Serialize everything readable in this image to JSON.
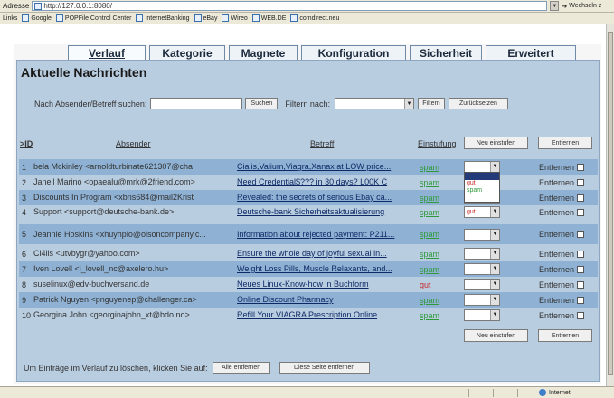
{
  "browser": {
    "address_label": "Adresse",
    "url": "http://127.0.0.1:8080/",
    "go_label": "Wechseln z",
    "links_label": "Links",
    "links": [
      "Google",
      "POPFile Control Center",
      "InternetBanking",
      "eBay",
      "Wireo",
      "WEB.DE",
      "comdirect.neu"
    ],
    "status_zone": "Internet"
  },
  "nav": {
    "tabs": [
      {
        "label": "Verlauf",
        "active": true
      },
      {
        "label": "Kategorie",
        "active": false
      },
      {
        "label": "Magnete",
        "active": false
      },
      {
        "label": "Konfiguration",
        "active": false
      },
      {
        "label": "Sicherheit",
        "active": false
      },
      {
        "label": "Erweitert",
        "active": false
      }
    ]
  },
  "page": {
    "title": "Aktuelle Nachrichten",
    "search_label": "Nach Absender/Betreff suchen:",
    "search_value": "",
    "search_button": "Suchen",
    "filter_label": "Filtern nach:",
    "filter_value": "",
    "filter_button": "Filtern",
    "reset_button": "Zurücksetzen"
  },
  "table": {
    "headers": {
      "id": ">ID",
      "sender": "Absender",
      "subject": "Betreff",
      "classification": "Einstufung",
      "reclassify_button": "Neu einstufen",
      "remove_button": "Entfernen"
    },
    "rows": [
      {
        "id": "1",
        "sender": "bela Mckinley <arnoldturbinate621307@cha",
        "subject": "Cialis,Valium,Viagra,Xanax at LOW price...",
        "classification": "spam",
        "reclass": "",
        "remove": "Entfernen"
      },
      {
        "id": "2",
        "sender": "Janell Marino <opaealu@mrk@2friend.com>",
        "subject": "Need Credential$??? in 30 days? L00K C",
        "classification": "spam",
        "reclass": "",
        "remove": "Entfernen"
      },
      {
        "id": "3",
        "sender": "Discounts In Program <xbns684@mail2Krist",
        "subject": "Revealed: the secrets of serious Ebay ca...",
        "classification": "spam",
        "reclass": "",
        "remove": "Entfernen"
      },
      {
        "id": "4",
        "sender": "Support <support@deutsche-bank.de>",
        "subject": "Deutsche-bank Sicherheitsaktualisierung",
        "classification": "spam",
        "reclass": "gut",
        "remove": "Entfernen"
      },
      {
        "id": "5",
        "sender": "Jeannie Hoskins <xhuyhpio@olsoncompany.c...",
        "subject": "Information about rejected payment: P211...",
        "classification": "spam",
        "reclass": "",
        "remove": "Entfernen"
      },
      {
        "id": "6",
        "sender": "Ci4lis <utvbygr@yahoo.com>",
        "subject": "Ensure the whole day of joyful sexual in...",
        "classification": "spam",
        "reclass": "",
        "remove": "Entfernen"
      },
      {
        "id": "7",
        "sender": "Iven Lovell <i_lovell_nc@axelero.hu>",
        "subject": "Weight Loss Pills, Muscle Relaxants, and...",
        "classification": "spam",
        "reclass": "",
        "remove": "Entfernen"
      },
      {
        "id": "8",
        "sender": "suselinux@edv-buchversand.de",
        "subject": "Neues Linux-Know-how in Buchform",
        "classification": "gut",
        "reclass": "",
        "remove": "Entfernen"
      },
      {
        "id": "9",
        "sender": "Patrick Nguyen <pnguyenep@challenger.ca>",
        "subject": "Online Discount Pharmacy",
        "classification": "spam",
        "reclass": "",
        "remove": "Entfernen"
      },
      {
        "id": "10",
        "sender": "Georgina John <georginajohn_xt@bdo.no>",
        "subject": "Refill Your VIAGRA Prescription Online",
        "classification": "spam",
        "reclass": "",
        "remove": "Entfernen"
      }
    ],
    "dropdown_options": [
      "",
      "gut",
      "spam"
    ],
    "bottom_reclassify_button": "Neu einstufen",
    "bottom_remove_button": "Entfernen"
  },
  "footer": {
    "text": "Um Einträge im Verlauf zu löschen, klicken Sie auf:",
    "remove_all_button": "Alle entfernen",
    "remove_page_button": "Diese Seite entfernen"
  },
  "colors": {
    "panel_bg": "#b9cde0",
    "row_alt": "#8fb2d4",
    "spam": "#2f9a3a",
    "gut": "#c62828",
    "link": "#0e2a66"
  }
}
